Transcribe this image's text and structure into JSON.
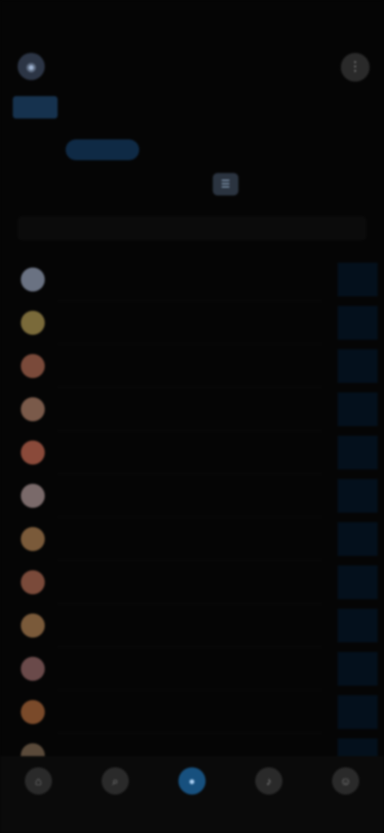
{
  "status_bar": {
    "time": "",
    "icons": ""
  },
  "header": {
    "title": "",
    "logo_icon": "app-logo",
    "menu_icon": "more-icon"
  },
  "tabs": [
    {
      "label": ""
    },
    {
      "label": ""
    },
    {
      "label": ""
    },
    {
      "label": ""
    },
    {
      "label": ""
    },
    {
      "label": ""
    },
    {
      "label": ""
    },
    {
      "label": ""
    }
  ],
  "subtabs": [
    {
      "label": ""
    },
    {
      "label": ""
    }
  ],
  "filter": {
    "label": "",
    "icon": "filter-icon"
  },
  "list_header": {
    "label": ""
  },
  "rows": [
    {
      "name": "",
      "tag": "",
      "value": "",
      "color": "#6a7282"
    },
    {
      "name": "",
      "tag": "",
      "value": "",
      "color": "#7a6a3a"
    },
    {
      "name": "",
      "tag": "",
      "value": "",
      "color": "#7a4a3a"
    },
    {
      "name": "",
      "tag": "",
      "value": "",
      "color": "#7a5a4a"
    },
    {
      "name": "",
      "tag": "",
      "value": "",
      "color": "#8a4a3a"
    },
    {
      "name": "",
      "tag": "",
      "value": "",
      "color": "#7a6a6a"
    },
    {
      "name": "",
      "tag": "",
      "value": "",
      "color": "#7a5a3a"
    },
    {
      "name": "",
      "tag": "",
      "value": "",
      "color": "#7a4a3a"
    },
    {
      "name": "",
      "tag": "",
      "value": "",
      "color": "#7a5a3a"
    },
    {
      "name": "",
      "tag": "",
      "value": "",
      "color": "#6a4a4a"
    },
    {
      "name": "",
      "tag": "",
      "value": "",
      "color": "#7a4a2a"
    },
    {
      "name": "",
      "tag": "",
      "value": "",
      "color": "#5a4a3a"
    }
  ],
  "bottom_nav": [
    {
      "label": "",
      "icon": "home-icon"
    },
    {
      "label": "",
      "icon": "search-icon"
    },
    {
      "label": "",
      "icon": "center-action-icon"
    },
    {
      "label": "",
      "icon": "notifications-icon"
    },
    {
      "label": "",
      "icon": "profile-icon"
    }
  ],
  "colors": {
    "background": "#050505",
    "accent": "#17507e",
    "tag": "#1c3b2d"
  }
}
